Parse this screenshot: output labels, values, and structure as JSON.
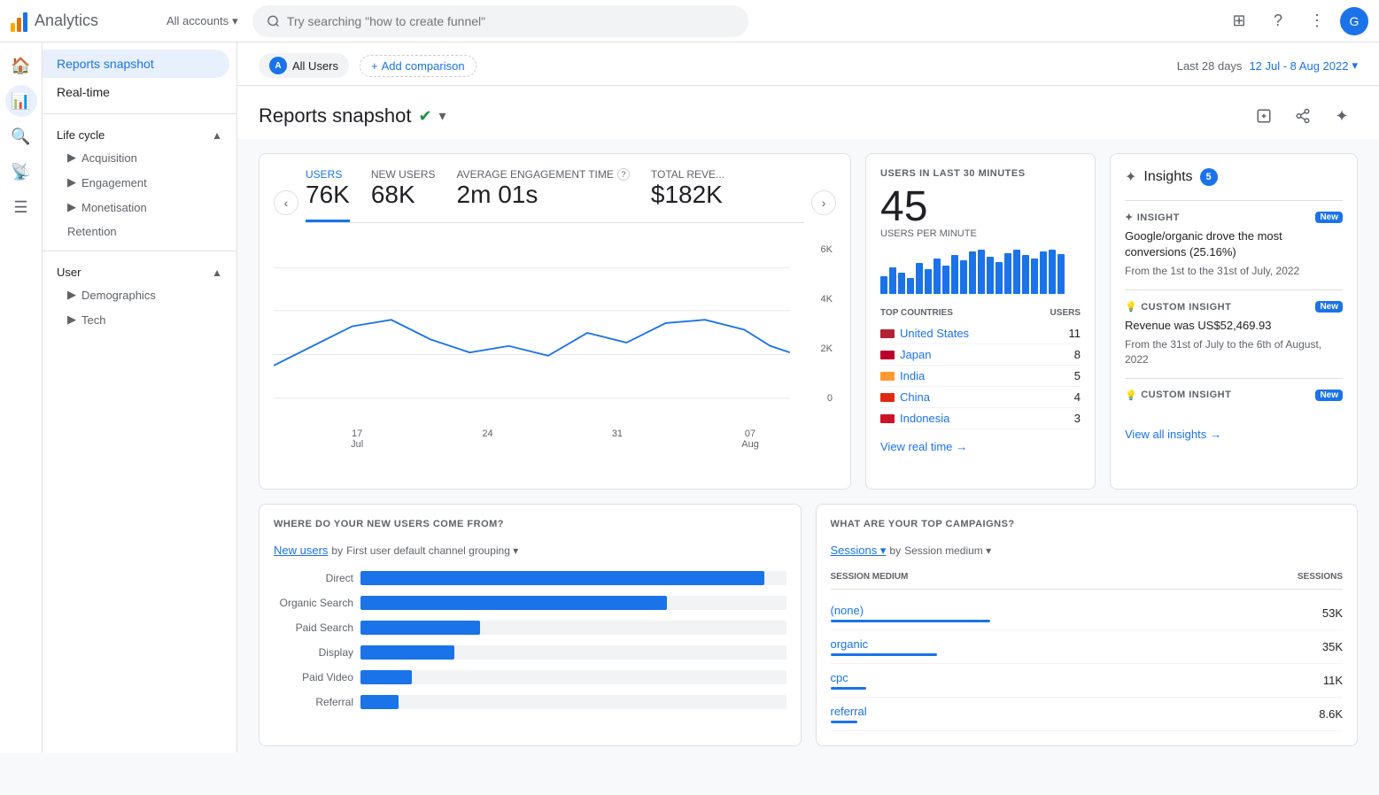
{
  "topNav": {
    "appName": "Analytics",
    "accountsLabel": "All accounts",
    "searchPlaceholder": "Try searching \"how to create funnel\"",
    "avatarLetter": "G"
  },
  "sidebar": {
    "activeItem": "reports-snapshot",
    "items": [
      {
        "id": "reports-snapshot",
        "label": "Reports snapshot",
        "active": true
      },
      {
        "id": "real-time",
        "label": "Real-time",
        "active": false
      }
    ],
    "sections": [
      {
        "label": "Life cycle",
        "children": [
          "Acquisition",
          "Engagement",
          "Monetisation",
          "Retention"
        ]
      },
      {
        "label": "User",
        "children": [
          "Demographics",
          "Tech"
        ]
      }
    ]
  },
  "filterBar": {
    "allUsersLabel": "All Users",
    "addComparisonLabel": "Add comparison",
    "lastDaysLabel": "Last 28 days",
    "dateRange": "12 Jul - 8 Aug 2022"
  },
  "pageTitle": "Reports snapshot",
  "metrics": [
    {
      "label": "Users",
      "value": "76K",
      "active": true
    },
    {
      "label": "New users",
      "value": "68K",
      "active": false
    },
    {
      "label": "Average engagement time",
      "value": "2m 01s",
      "active": false
    },
    {
      "label": "Total reve...",
      "value": "$182K",
      "active": false
    }
  ],
  "chartYLabels": [
    "6K",
    "4K",
    "2K",
    "0"
  ],
  "chartXLabels": [
    {
      "date": "17",
      "month": "Jul"
    },
    {
      "date": "24",
      "month": ""
    },
    {
      "date": "31",
      "month": ""
    },
    {
      "date": "07",
      "month": "Aug"
    }
  ],
  "realtime": {
    "sectionTitle": "USERS IN LAST 30 MINUTES",
    "count": "45",
    "subLabel": "USERS PER MINUTE",
    "topCountriesTitle": "TOP COUNTRIES",
    "usersHeader": "USERS",
    "countries": [
      {
        "name": "United States",
        "count": 11
      },
      {
        "name": "Japan",
        "count": 8
      },
      {
        "name": "India",
        "count": 5
      },
      {
        "name": "China",
        "count": 4
      },
      {
        "name": "Indonesia",
        "count": 3
      }
    ],
    "viewRealtimeLabel": "View real time",
    "miniBars": [
      20,
      30,
      25,
      40,
      35,
      45,
      30,
      50,
      40,
      60,
      55,
      70,
      65,
      80,
      55,
      45,
      70,
      65,
      75,
      60,
      50
    ]
  },
  "insights": {
    "title": "Insights",
    "count": "5",
    "items": [
      {
        "type": "INSIGHT",
        "isNew": true,
        "icon": "✦",
        "text": "Google/organic drove the most conversions (25.16%)",
        "sub": "From the 1st to the 31st of July, 2022"
      },
      {
        "type": "CUSTOM INSIGHT",
        "isNew": true,
        "icon": "💡",
        "text": "Revenue was US$52,469.93",
        "sub": "From the 31st of July to the 6th of August, 2022"
      },
      {
        "type": "CUSTOM INSIGHT",
        "isNew": true,
        "icon": "💡",
        "text": "",
        "sub": ""
      }
    ],
    "viewAllLabel": "View all insights"
  },
  "newUsers": {
    "sectionTitle": "WHERE DO YOUR NEW USERS COME FROM?",
    "subtitle": "New users",
    "subtitleSuffix": "by First user default channel grouping",
    "bars": [
      {
        "label": "Direct",
        "pct": 95
      },
      {
        "label": "Organic Search",
        "pct": 72
      },
      {
        "label": "Paid Search",
        "pct": 28
      },
      {
        "label": "Display",
        "pct": 22
      },
      {
        "label": "Paid Video",
        "pct": 12
      },
      {
        "label": "Referral",
        "pct": 10
      }
    ]
  },
  "campaigns": {
    "sectionTitle": "WHAT ARE YOUR TOP CAMPAIGNS?",
    "subtitle": "Sessions",
    "subtitleBy": "by Session medium",
    "sessionMediumHeader": "SESSION MEDIUM",
    "sessionsHeader": "SESSIONS",
    "rows": [
      {
        "medium": "(none)",
        "count": "53K",
        "barPct": 90
      },
      {
        "medium": "organic",
        "count": "35K",
        "barPct": 60
      },
      {
        "medium": "cpc",
        "count": "11K",
        "barPct": 20
      },
      {
        "medium": "referral",
        "count": "8.6K",
        "barPct": 15
      }
    ]
  }
}
